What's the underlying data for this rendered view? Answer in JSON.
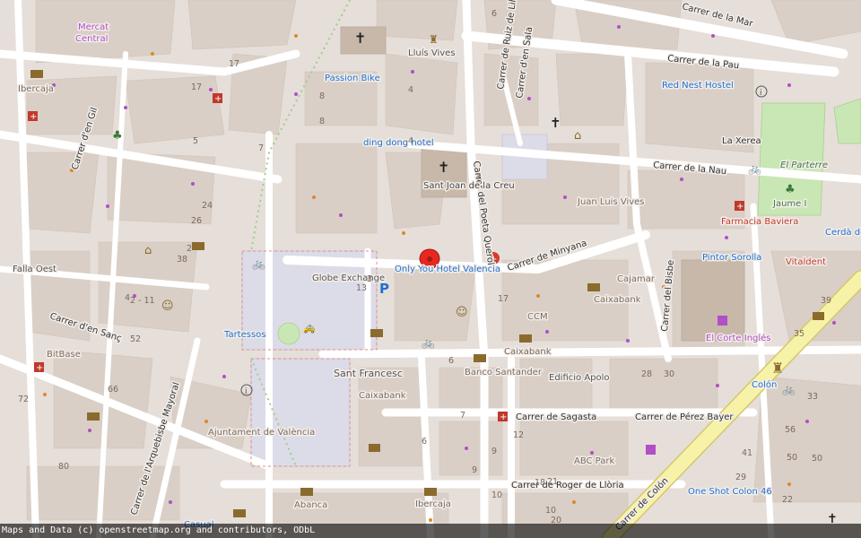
{
  "map": {
    "attribution": "Maps and Data (c) openstreetmap.org and contributors, ODbL",
    "colors": {
      "land": "#e6ded8",
      "block": "#d9cfc6",
      "road": "#ffffff",
      "major": "#f6f3a8",
      "park": "#c9e7b5",
      "square": "#dcdbe8",
      "marker": "#e8281f"
    },
    "streets": {
      "carrer_de_la_mar": "Carrer de la Mar",
      "carrer_de_la_pau": "Carrer de la Pau",
      "carrer_de_la_nau": "Carrer de la Nau",
      "carrer_de_minyana": "Carrer de Minyana",
      "carrer_del_poeta_querol": "Carrer del Poeta Querol",
      "carrer_de_ruiz": "Carrer de Ruiz de Lihory",
      "carrer_en_sala": "Carrer d'en Sala",
      "carrer_de_sagasta": "Carrer de Sagasta",
      "carrer_de_perez_bayer": "Carrer de Pérez Bayer",
      "carrer_de_roger": "Carrer de Roger de Llòria",
      "carrer_del_bisbe": "Carrer del Bisbe",
      "carrer_de_colon": "Carrer de Colón",
      "carrer_arquebisbe": "Carrer de l'Arquebisbe Mayoral",
      "carrer_en_gil": "Carrer d'en Gil",
      "carrer_en_sanc": "Carrer d'en Sanç",
      "carrer_la_xerea": "La Xerea"
    },
    "places": {
      "mercat": "Mercat Central",
      "mercat_top": "Mercat",
      "mercat_top2": "Central",
      "lluis_vives": "Lluís Vives",
      "passion_bike": "Passion Bike",
      "red_nest": "Red Nest Hostel",
      "ding_dong": "ding dong hotel",
      "sant_joan": "Sant Joan de la Creu",
      "juan_luis": "Juan Luis Vives",
      "el_parterre": "El Parterre",
      "jaume": "Jaume I",
      "farmacia": "Farmacia Baviera",
      "cerda": "Cerdà de Tallac - Colón",
      "pintor": "Pintor Sorolla",
      "vitaldent": "Vitaldent",
      "only_hotel": "Only You Hotel Valencia",
      "globe": "Globe Exchange",
      "cajamar": "Cajamar",
      "caixabank1": "Caixabank",
      "ccm": "CCM",
      "caixabank2": "Caixabank",
      "el_corte": "El Corte Inglés",
      "tartessos": "Tartessos",
      "sant_francesc": "Sant Francesc",
      "caixabank3": "Caixabank",
      "banco": "Banco Santander",
      "edificio": "Edificio Apolo",
      "colon": "Colón",
      "ajuntament": "Ajuntament de València",
      "abc_park": "ABC Park",
      "one_shot": "One Shot Colon 46",
      "abanca": "Abanca",
      "ibercaja1": "Ibercaja",
      "ibercaja2": "Ibercaja",
      "bitbase": "BitBase",
      "falla_oest": "Falla Oest",
      "casual": "Casual"
    },
    "numbers": [
      "4",
      "6",
      "17",
      "17",
      "8",
      "7",
      "8",
      "5",
      "4",
      "3",
      "24",
      "26",
      "38",
      "2",
      "4",
      "2 - 11",
      "52",
      "66",
      "13",
      "3",
      "17",
      "6",
      "28",
      "30",
      "39",
      "35",
      "33",
      "56",
      "50",
      "50",
      "22",
      "29",
      "41",
      "80",
      "72",
      "18",
      "21",
      "9",
      "9",
      "12",
      "6",
      "7",
      "10",
      "10",
      "20"
    ]
  }
}
